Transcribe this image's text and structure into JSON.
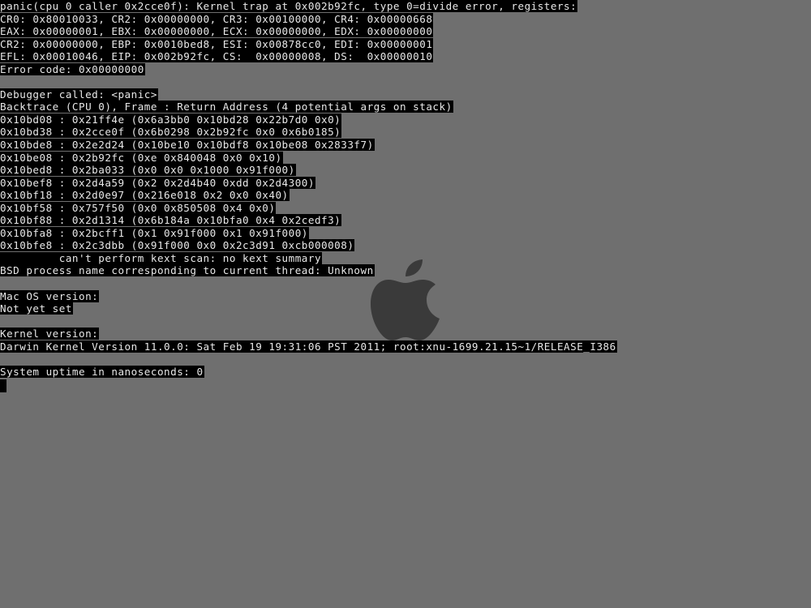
{
  "colors": {
    "background": "#6f6f6f",
    "text_background": "#000000",
    "text": "#e8e8e8",
    "logo": "#3a3a3a"
  },
  "logo": {
    "icon": "apple-logo-icon"
  },
  "console": {
    "lines": [
      "panic(cpu 0 caller 0x2cce0f): Kernel trap at 0x002b92fc, type 0=divide error, registers:",
      "CR0: 0x80010033, CR2: 0x00000000, CR3: 0x00100000, CR4: 0x00000668",
      "EAX: 0x00000001, EBX: 0x00000000, ECX: 0x00000000, EDX: 0x00000000",
      "CR2: 0x00000000, EBP: 0x0010bed8, ESI: 0x00878cc0, EDI: 0x00000001",
      "EFL: 0x00010046, EIP: 0x002b92fc, CS:  0x00000008, DS:  0x00000010",
      "Error code: 0x00000000",
      "",
      "Debugger called: <panic>",
      "Backtrace (CPU 0), Frame : Return Address (4 potential args on stack)",
      "0x10bd08 : 0x21ff4e (0x6a3bb0 0x10bd28 0x22b7d0 0x0)",
      "0x10bd38 : 0x2cce0f (0x6b0298 0x2b92fc 0x0 0x6b0185)",
      "0x10bde8 : 0x2e2d24 (0x10be10 0x10bdf8 0x10be08 0x2833f7)",
      "0x10be08 : 0x2b92fc (0xe 0x840048 0x0 0x10)",
      "0x10bed8 : 0x2ba033 (0x0 0x0 0x1000 0x91f000)",
      "0x10bef8 : 0x2d4a59 (0x2 0x2d4b40 0xdd 0x2d4300)",
      "0x10bf18 : 0x2d0e97 (0x216e018 0x2 0x0 0x40)",
      "0x10bf58 : 0x757f50 (0x0 0x850508 0x4 0x0)",
      "0x10bf88 : 0x2d1314 (0x6b184a 0x10bfa0 0x4 0x2cedf3)",
      "0x10bfa8 : 0x2bcff1 (0x1 0x91f000 0x1 0x91f000)",
      "0x10bfe8 : 0x2c3dbb (0x91f000 0x0 0x2c3d91 0xcb000008)",
      "         can't perform kext scan: no kext summary",
      "BSD process name corresponding to current thread: Unknown",
      "",
      "Mac OS version:",
      "Not yet set",
      "",
      "Kernel version:",
      "Darwin Kernel Version 11.0.0: Sat Feb 19 19:31:06 PST 2011; root:xnu-1699.21.15~1/RELEASE_I386",
      "",
      "System uptime in nanoseconds: 0"
    ]
  }
}
